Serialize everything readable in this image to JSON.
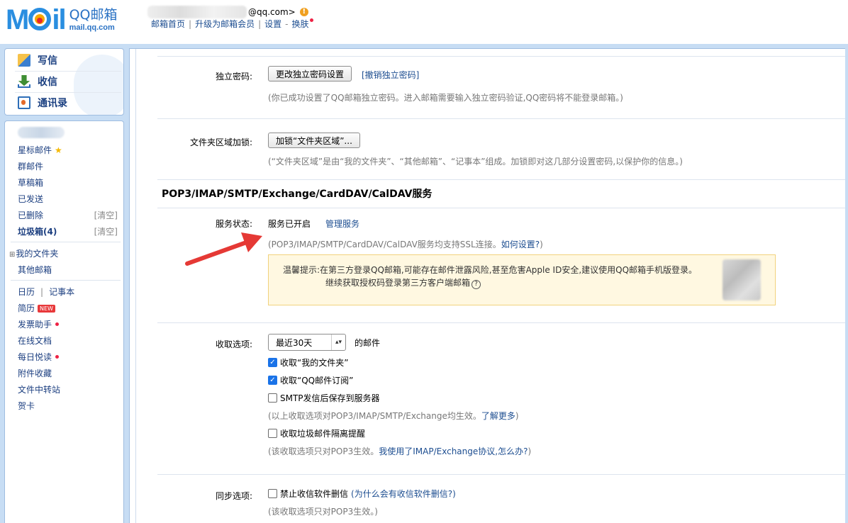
{
  "header": {
    "logo_word": "MAIL",
    "logo_cn": "QQ邮箱",
    "logo_en": "mail.qq.com",
    "email_suffix": "@qq.com>",
    "links": [
      "邮箱首页",
      "升级为邮箱会员",
      "设置",
      "换肤"
    ]
  },
  "nav_top": {
    "write": "写信",
    "receive": "收信",
    "contacts": "通讯录"
  },
  "nav": {
    "starred": "星标邮件",
    "group": "群邮件",
    "drafts": "草稿箱",
    "sent": "已发送",
    "deleted": "已删除",
    "deleted_clear": "[清空]",
    "spam": "垃圾箱(4)",
    "spam_clear": "[清空]",
    "my_folders": "我的文件夹",
    "other_mail": "其他邮箱",
    "calendar": "日历",
    "calendar_sep": "|",
    "notes": "记事本",
    "resume": "简历",
    "new_badge": "NEW",
    "invoice": "发票助手",
    "docs": "在线文档",
    "daily": "每日悦读",
    "attachments": "附件收藏",
    "transfer": "文件中转站",
    "cards": "贺卡"
  },
  "main": {
    "pwd_label": "独立密码:",
    "pwd_button": "更改独立密码设置",
    "pwd_revoke": "[撤销独立密码]",
    "pwd_hint": "(你已成功设置了QQ邮箱独立密码。进入邮箱需要输入独立密码验证,QQ密码将不能登录邮箱。)",
    "folder_label": "文件夹区域加锁:",
    "folder_button": "加锁“文件夹区域”...",
    "folder_hint": "(“文件夹区域”是由“我的文件夹”、“其他邮箱”、“记事本”组成。加锁即对这几部分设置密码,以保护你的信息。)",
    "section_title": "POP3/IMAP/SMTP/Exchange/CardDAV/CalDAV服务",
    "status_label": "服务状态:",
    "status_value": "服务已开启",
    "manage_link": "管理服务",
    "ssl_hint": "(POP3/IMAP/SMTP/CardDAV/CalDAV服务均支持SSL连接。",
    "ssl_link": "如何设置?",
    "ssl_end": ")",
    "notice_line1": "温馨提示:在第三方登录QQ邮箱,可能存在邮件泄露风险,甚至危害Apple ID安全,建议使用QQ邮箱手机版登录。",
    "notice_line2": "继续获取授权码登录第三方客户端邮箱",
    "notice_help": "?",
    "recv_label": "收取选项:",
    "recv_select": "最近30天",
    "recv_suffix": "的邮件",
    "cb1": "收取“我的文件夹”",
    "cb2": "收取“QQ邮件订阅”",
    "cb3": "SMTP发信后保存到服务器",
    "recv_hint": "(以上收取选项对POP3/IMAP/SMTP/Exchange均生效。",
    "recv_hint_link": "了解更多",
    "recv_hint_end": ")",
    "cb4": "收取垃圾邮件隔离提醒",
    "pop3_hint": "(该收取选项只对POP3生效。",
    "pop3_hint_link": "我使用了IMAP/Exchange协议,怎么办?",
    "pop3_hint_end": ")",
    "sync_label": "同步选项:",
    "cb5": "禁止收信软件删信",
    "cb5_link": "(为什么会有收信软件删信?)",
    "sync_hint": "(该收取选项只对POP3生效。)"
  }
}
